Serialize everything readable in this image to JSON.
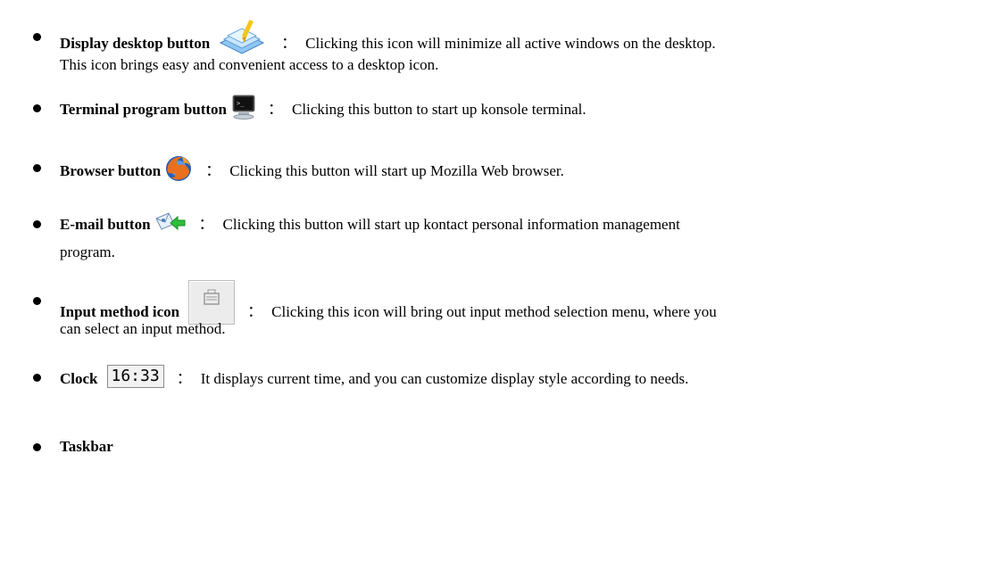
{
  "items": [
    {
      "term": "Display desktop button",
      "colon": "：",
      "text": "Clicking this icon will minimize all active windows on the desktop.",
      "continuation": "This icon brings easy and convenient access to a desktop icon.",
      "icon": "desktop-icon"
    },
    {
      "term": "Terminal program button",
      "colon": "：",
      "text": "Clicking this button to start up konsole terminal.",
      "icon": "terminal-icon"
    },
    {
      "term": "Browser button",
      "colon": "：",
      "text": "Clicking this button will start up Mozilla Web browser.",
      "icon": "firefox-icon"
    },
    {
      "term": "E-mail button",
      "colon": "：",
      "text": "Clicking this button will start up kontact personal information management",
      "continuation": "program.",
      "icon": "email-icon"
    },
    {
      "term": "Input method icon",
      "colon": "：",
      "text": "Clicking this icon will bring out input method selection menu, where you",
      "continuation": "can select an input method.",
      "icon": "input-method-icon"
    },
    {
      "term": "Clock",
      "colon": "：",
      "text": "It displays current time, and you can customize display style according to needs.",
      "clock_value": "16:33"
    },
    {
      "term": "Taskbar"
    }
  ]
}
